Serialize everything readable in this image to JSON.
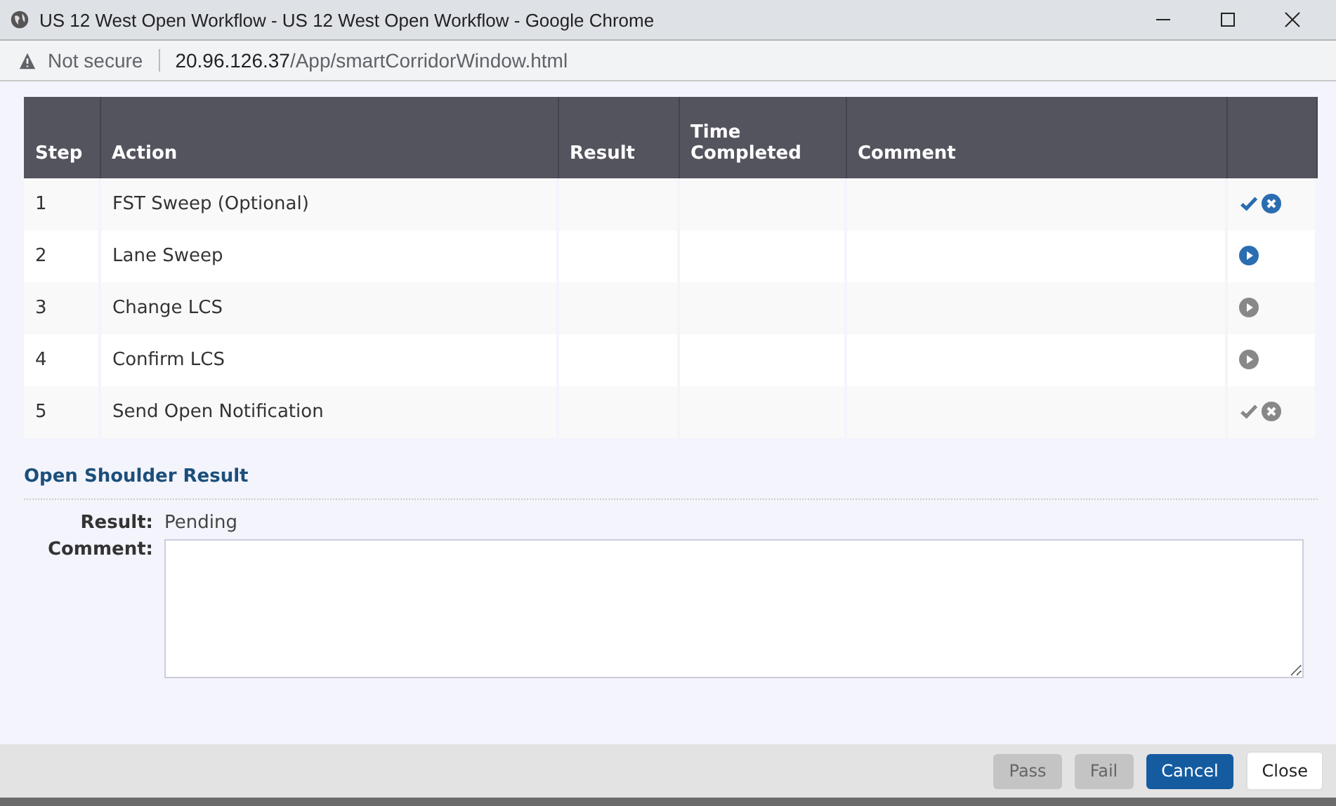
{
  "window": {
    "title": "US 12 West Open Workflow - US 12 West Open Workflow - Google Chrome"
  },
  "address_bar": {
    "security": "Not secure",
    "host": "20.96.126.37",
    "path": "/App/smartCorridorWindow.html"
  },
  "table": {
    "columns": [
      "Step",
      "Action",
      "Result",
      "Time Completed",
      "Comment"
    ],
    "rows": [
      {
        "step": "1",
        "action": "FST Sweep (Optional)",
        "actions": [
          {
            "kind": "check",
            "enabled": true
          },
          {
            "kind": "cancel",
            "enabled": true
          }
        ]
      },
      {
        "step": "2",
        "action": "Lane Sweep",
        "actions": [
          {
            "kind": "play",
            "enabled": true
          }
        ]
      },
      {
        "step": "3",
        "action": "Change LCS",
        "actions": [
          {
            "kind": "play",
            "enabled": false
          }
        ]
      },
      {
        "step": "4",
        "action": "Confirm LCS",
        "actions": [
          {
            "kind": "play",
            "enabled": false
          }
        ]
      },
      {
        "step": "5",
        "action": "Send Open Notification",
        "actions": [
          {
            "kind": "check",
            "enabled": false
          },
          {
            "kind": "cancel",
            "enabled": false
          }
        ]
      }
    ]
  },
  "result_section": {
    "title": "Open Shoulder Result",
    "result_label": "Result:",
    "result_value": "Pending",
    "comment_label": "Comment:"
  },
  "buttons": [
    {
      "label": "Pass",
      "kind": "primary",
      "disabled": true
    },
    {
      "label": "Fail",
      "kind": "primary",
      "disabled": true
    },
    {
      "label": "Cancel",
      "kind": "primary",
      "disabled": false
    },
    {
      "label": "Close",
      "kind": "default",
      "disabled": false
    }
  ]
}
